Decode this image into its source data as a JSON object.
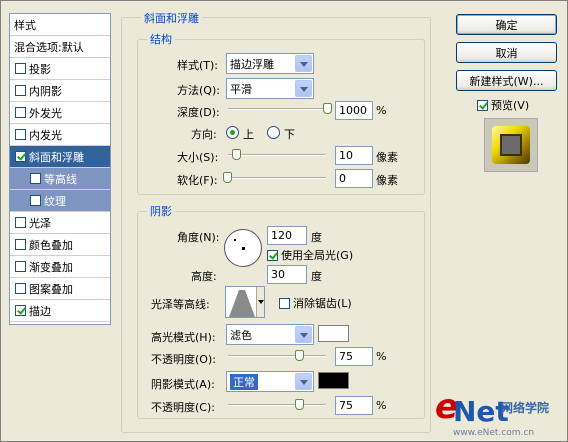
{
  "sidebar": {
    "header": "样式",
    "items": [
      {
        "label": "混合选项:默认",
        "checkbox": false,
        "type": "plain"
      },
      {
        "label": "投影",
        "checkbox": true,
        "checked": false,
        "type": "item"
      },
      {
        "label": "内阴影",
        "checkbox": true,
        "checked": false,
        "type": "item"
      },
      {
        "label": "外发光",
        "checkbox": true,
        "checked": false,
        "type": "item"
      },
      {
        "label": "内发光",
        "checkbox": true,
        "checked": false,
        "type": "item"
      },
      {
        "label": "斜面和浮雕",
        "checkbox": true,
        "checked": true,
        "type": "selected"
      },
      {
        "label": "等高线",
        "checkbox": true,
        "checked": false,
        "type": "sub"
      },
      {
        "label": "纹理",
        "checkbox": true,
        "checked": false,
        "type": "sub"
      },
      {
        "label": "光泽",
        "checkbox": true,
        "checked": false,
        "type": "item"
      },
      {
        "label": "颜色叠加",
        "checkbox": true,
        "checked": false,
        "type": "item"
      },
      {
        "label": "渐变叠加",
        "checkbox": true,
        "checked": false,
        "type": "item"
      },
      {
        "label": "图案叠加",
        "checkbox": true,
        "checked": false,
        "type": "item"
      },
      {
        "label": "描边",
        "checkbox": true,
        "checked": true,
        "type": "item"
      }
    ]
  },
  "bevel": {
    "legend": "斜面和浮雕",
    "structure": {
      "legend": "结构",
      "style_label": "样式(T):",
      "style_value": "描边浮雕",
      "technique_label": "方法(Q):",
      "technique_value": "平滑",
      "depth_label": "深度(D):",
      "depth_value": "1000",
      "depth_unit": "%",
      "depth_level": 1.0,
      "direction_label": "方向:",
      "direction_up": "上",
      "direction_down": "下",
      "direction_selected": "上",
      "size_label": "大小(S):",
      "size_value": "10",
      "size_unit": "像素",
      "size_level": 0.04,
      "soften_label": "软化(F):",
      "soften_value": "0",
      "soften_unit": "像素",
      "soften_level": 0.0
    },
    "shading": {
      "legend": "阴影",
      "angle_label": "角度(N):",
      "angle_value": "120",
      "angle_unit": "度",
      "global_light_label": "使用全局光(G)",
      "global_light_checked": true,
      "altitude_label": "高度:",
      "altitude_value": "30",
      "altitude_unit": "度",
      "gloss_contour_label": "光泽等高线:",
      "antialiased_label": "消除锯齿(L)",
      "antialiased_checked": false,
      "highlight_mode_label": "高光模式(H):",
      "highlight_mode_value": "滤色",
      "highlight_color": "#ffffff",
      "highlight_opacity_label": "不透明度(O):",
      "highlight_opacity_value": "75",
      "highlight_opacity_unit": "%",
      "highlight_opacity_level": 0.75,
      "shadow_mode_label": "阴影模式(A):",
      "shadow_mode_value": "正常",
      "shadow_color": "#000000",
      "shadow_opacity_label": "不透明度(C):",
      "shadow_opacity_value": "75",
      "shadow_opacity_unit": "%",
      "shadow_opacity_level": 0.75
    }
  },
  "buttons": {
    "ok": "确定",
    "cancel": "取消",
    "new_style": "新建样式(W)...",
    "preview_label": "预览(V)",
    "preview_checked": true
  },
  "watermark": {
    "brand_e": "e",
    "brand_net": "Net",
    "cn": "网络学院",
    "url": "www.eNet.com.cn"
  },
  "colors": {
    "selected_bg": "#31629c",
    "sub_bg": "#7e95c2",
    "legend_blue": "#0046d5",
    "checkmark": "#21a121"
  }
}
